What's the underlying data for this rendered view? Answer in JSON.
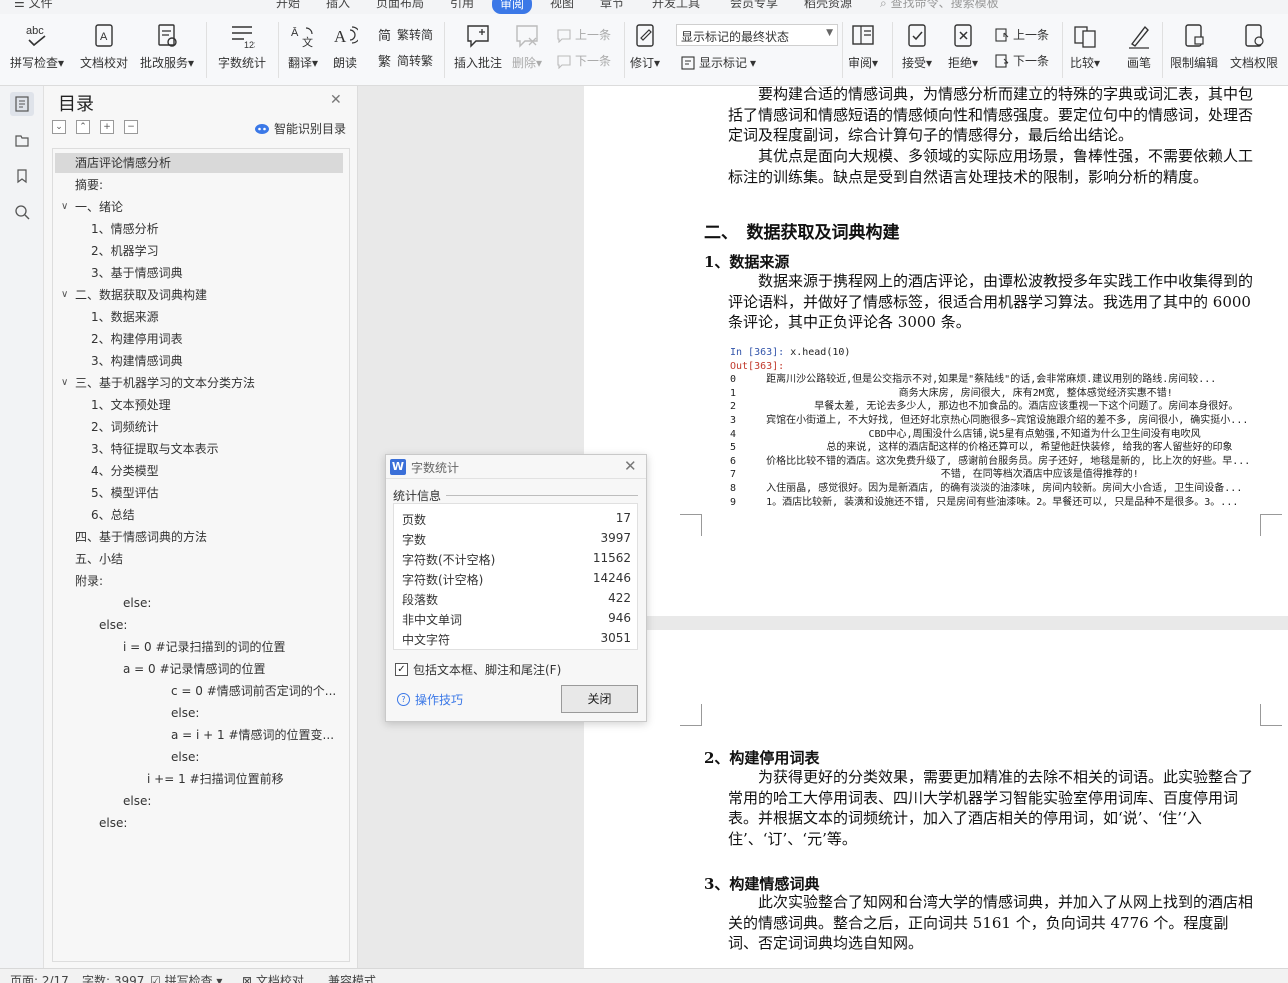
{
  "menu": {
    "file": "☰ 文件",
    "tabs": [
      "开始",
      "插入",
      "页面布局",
      "引用",
      "审阅",
      "视图",
      "章节",
      "开发工具",
      "会员专享",
      "稻壳资源"
    ],
    "active_tab": "审阅",
    "search_placeholder": "查找命令、搜索模板"
  },
  "ribbon": {
    "spell_check": "拼写检查",
    "doc_proof": "文档校对",
    "review_service": "批改服务",
    "word_count": "字数统计",
    "translate": "翻译",
    "read_aloud": "朗读",
    "trad_to_simp": "繁转简",
    "simp_to_trad": "简转繁",
    "insert_comment": "插入批注",
    "delete": "删除",
    "prev_comment": "上一条",
    "next_comment": "下一条",
    "revise": "修订",
    "markup_select": "显示标记的最终状态",
    "show_markup": "显示标记",
    "review_pane": "审阅",
    "accept": "接受",
    "reject": "拒绝",
    "prev_change": "上一条",
    "next_change": "下一条",
    "compare": "比较",
    "pen": "画笔",
    "restrict_edit": "限制编辑",
    "doc_permission": "文档权限"
  },
  "toc": {
    "title": "目录",
    "smart_label": "智能识别目录",
    "items": [
      {
        "text": "酒店评论情感分析",
        "selected": true
      },
      {
        "text": "摘要:"
      },
      {
        "text": "一、绪论",
        "toggle": "∨"
      },
      {
        "text": "1、情感分析"
      },
      {
        "text": "2、机器学习"
      },
      {
        "text": "3、基于情感词典"
      },
      {
        "text": "二、数据获取及词典构建",
        "toggle": "∨"
      },
      {
        "text": "1、数据来源"
      },
      {
        "text": "2、构建停用词表"
      },
      {
        "text": "3、构建情感词典"
      },
      {
        "text": "三、基于机器学习的文本分类方法",
        "toggle": "∨"
      },
      {
        "text": "1、文本预处理"
      },
      {
        "text": "2、词频统计"
      },
      {
        "text": "3、特征提取与文本表示"
      },
      {
        "text": "4、分类模型"
      },
      {
        "text": "5、模型评估"
      },
      {
        "text": "6、总结"
      },
      {
        "text": "四、基于情感词典的方法"
      },
      {
        "text": "五、小结"
      },
      {
        "text": "附录:"
      },
      {
        "text": "else:"
      },
      {
        "text": "else:"
      },
      {
        "text": "i = 0 #记录扫描到的词的位置"
      },
      {
        "text": "a = 0 #记录情感词的位置"
      },
      {
        "text": "c = 0 #情感词前否定词的个..."
      },
      {
        "text": "else:"
      },
      {
        "text": "a = i + 1 #情感词的位置变..."
      },
      {
        "text": "else:"
      },
      {
        "text": "i += 1 #扫描词位置前移"
      },
      {
        "text": "else:"
      },
      {
        "text": "else:"
      }
    ]
  },
  "doc": {
    "p1": "要构建合适的情感词典，为情感分析而建立的特殊的字典或词汇表，其中包括了情感词和情感短语的情感倾向性和情感强度。要定位句中的情感词，处理否定词及程度副词，综合计算句子的情感得分，最后给出结论。",
    "p2": "其优点是面向大规模、多领域的实际应用场景，鲁棒性强，不需要依赖人工标注的训练集。缺点是受到自然语言处理技术的限制，影响分析的精度。",
    "h2": "二、　数据获取及词典构建",
    "h3a": "1、数据来源",
    "p3": "数据来源于携程网上的酒店评论，由谭松波教授多年实践工作中收集得到的评论语料，并做好了情感标签，很适合用机器学习算法。我选用了其中的 6000 条评论，其中正负评论各 3000 条。",
    "code_in_prompt": "In [363]:",
    "code_in_cmd": " x.head(10)",
    "code_out": "Out[363]:",
    "code_rows": [
      "0     距离川沙公路较近,但是公交指示不对,如果是\"蔡陆线\"的话,会非常麻烦.建议用别的路线.房间较...",
      "1                           商务大床房, 房间很大, 床有2M宽, 整体感觉经济实惠不错!",
      "2             早餐太差, 无论去多少人, 那边也不加食品的。酒店应该重视一下这个问题了。房间本身很好。",
      "3     宾馆在小街道上, 不大好找, 但还好北京热心同胞很多~宾馆设施跟介绍的差不多, 房间很小, 确实挺小...",
      "4                      CBD中心,周围没什么店铺,说5星有点勉强,不知道为什么卫生间没有电吹风",
      "5               总的来说, 这样的酒店配这样的价格还算可以, 希望他赶快装修, 给我的客人留些好的印象",
      "6     价格比比较不错的酒店。这次免费升级了, 感谢前台服务员。房子还好, 地毯是新的, 比上次的好些。早...",
      "7                                  不错, 在同等档次酒店中应该是值得推荐的!",
      "8     入住丽晶, 感觉很好。因为是新酒店, 的确有淡淡的油漆味, 房间内较新。房间大小合适, 卫生间设备...",
      "9     1。酒店比较新, 装潢和设施还不错, 只是房间有些油漆味。2。早餐还可以, 只是品种不是很多。3。..."
    ],
    "h3b": "2、构建停用词表",
    "p4": "为获得更好的分类效果，需要更加精准的去除不相关的词语。此实验整合了常用的哈工大停用词表、四川大学机器学习智能实验室停用词库、百度停用词表。并根据文本的词频统计，加入了酒店相关的停用词，如‘说’、‘住’‘入住’、‘订’、‘元’等。",
    "h3c": "3、构建情感词典",
    "p5": "此次实验整合了知网和台湾大学的情感词典，并加入了从网上找到的酒店相关的情感词典。整合之后，正向词共 5161 个，负向词共 4776 个。程度副词、否定词词典均选自知网。"
  },
  "dialog": {
    "title": "字数统计",
    "section": "统计信息",
    "stats": [
      {
        "label": "页数",
        "value": "17"
      },
      {
        "label": "字数",
        "value": "3997"
      },
      {
        "label": "字符数(不计空格)",
        "value": "11562"
      },
      {
        "label": "字符数(计空格)",
        "value": "14246"
      },
      {
        "label": "段落数",
        "value": "422"
      },
      {
        "label": "非中文单词",
        "value": "946"
      },
      {
        "label": "中文字符",
        "value": "3051"
      }
    ],
    "include_label": "包括文本框、脚注和尾注(F)",
    "include_checked": true,
    "tips": "操作技巧",
    "close": "关闭"
  },
  "status": {
    "page": "页面: 2/17",
    "words": "字数: 3997",
    "spell": "拼写检查",
    "proof": "文档校对",
    "compat": "兼容模式"
  },
  "colors": {
    "accent": "#3b78e7"
  }
}
